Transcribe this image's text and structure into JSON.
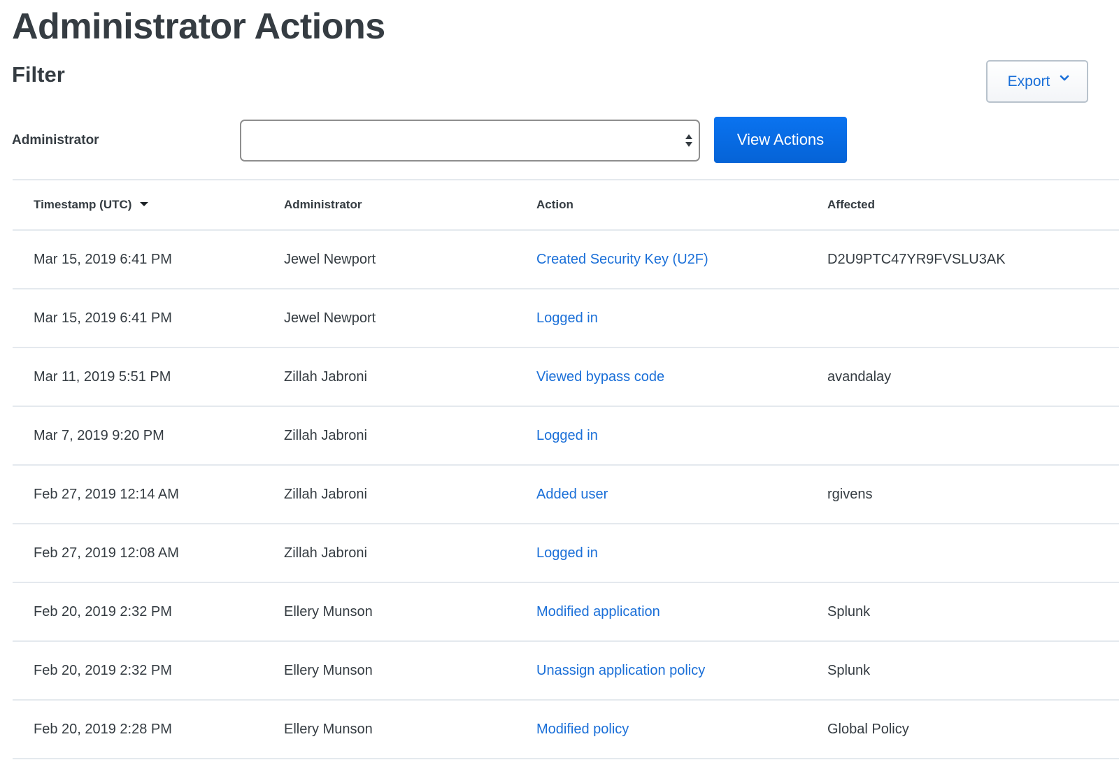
{
  "page": {
    "title": "Administrator Actions",
    "filter_heading": "Filter"
  },
  "toolbar": {
    "export_label": "Export",
    "export_icon": "chevron-down-icon"
  },
  "filter": {
    "administrator_label": "Administrator",
    "administrator_value": "",
    "select_icon": "up-down-arrows-icon",
    "view_actions_label": "View Actions"
  },
  "colors": {
    "link": "#1a6fd8",
    "primary_button": "#0a6ae6",
    "text": "#353c42",
    "divider": "#e4e9ee"
  },
  "table": {
    "columns": [
      {
        "label": "Timestamp (UTC)",
        "sorted": "descending"
      },
      {
        "label": "Administrator"
      },
      {
        "label": "Action"
      },
      {
        "label": "Affected"
      }
    ],
    "rows": [
      {
        "timestamp": "Mar 15, 2019 6:41 PM",
        "administrator": "Jewel Newport",
        "action": "Created Security Key (U2F)",
        "affected": "D2U9PTC47YR9FVSLU3AK"
      },
      {
        "timestamp": "Mar 15, 2019 6:41 PM",
        "administrator": "Jewel Newport",
        "action": "Logged in",
        "affected": ""
      },
      {
        "timestamp": "Mar 11, 2019 5:51 PM",
        "administrator": "Zillah Jabroni",
        "action": "Viewed bypass code",
        "affected": "avandalay"
      },
      {
        "timestamp": "Mar 7, 2019 9:20 PM",
        "administrator": "Zillah Jabroni",
        "action": "Logged in",
        "affected": ""
      },
      {
        "timestamp": "Feb 27, 2019 12:14 AM",
        "administrator": "Zillah Jabroni",
        "action": "Added user",
        "affected": "rgivens"
      },
      {
        "timestamp": "Feb 27, 2019 12:08 AM",
        "administrator": "Zillah Jabroni",
        "action": "Logged in",
        "affected": ""
      },
      {
        "timestamp": "Feb 20, 2019 2:32 PM",
        "administrator": "Ellery Munson",
        "action": "Modified application",
        "affected": "Splunk"
      },
      {
        "timestamp": "Feb 20, 2019 2:32 PM",
        "administrator": "Ellery Munson",
        "action": "Unassign application policy",
        "affected": "Splunk"
      },
      {
        "timestamp": "Feb 20, 2019 2:28 PM",
        "administrator": "Ellery Munson",
        "action": "Modified policy",
        "affected": "Global Policy"
      }
    ]
  }
}
